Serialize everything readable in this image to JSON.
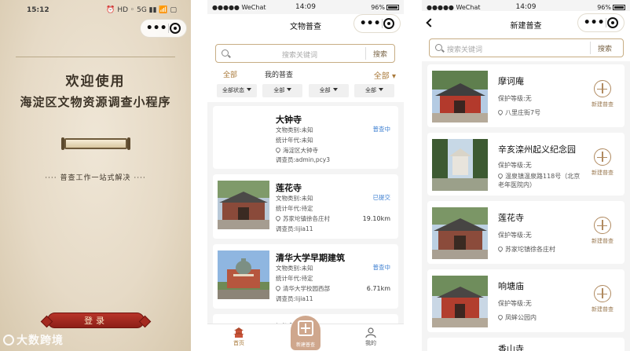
{
  "splash": {
    "status_time": "15:12",
    "status_right": "⏰ HD ◦ 5G ▮▮ 📶 ▢",
    "welcome": "欢迎使用",
    "app_title": "海淀区文物资源调查小程序",
    "slogan": "···· 普查工作一站式解决 ····",
    "login_label": "登录",
    "watermark": "大数跨境"
  },
  "list_screen": {
    "status_left": "●●●●● WeChat",
    "status_time": "14:09",
    "status_battery": "96%",
    "title": "文物普查",
    "search_placeholder": "搜索关键词",
    "search_button": "搜索",
    "tabs": {
      "all": "全部",
      "mine": "我的普查",
      "right": "全部 ▾"
    },
    "filters": [
      "全部状态",
      "全部",
      "全部",
      "全部"
    ],
    "items": [
      {
        "title": "大钟寺",
        "category": "文物类别:未知",
        "era": "统计年代:未知",
        "address": "海淀区大钟寺",
        "surveyor": "调查员:admin,pcy3",
        "status": "普查中",
        "distance": ""
      },
      {
        "title": "莲花寺",
        "category": "文物类别:未知",
        "era": "统计年代:待定",
        "address": "苏家坨镇徐各庄村",
        "surveyor": "调查员:lijia11",
        "status": "已提交",
        "distance": "19.10km"
      },
      {
        "title": "清华大学早期建筑",
        "category": "文物类别:未知",
        "era": "统计年代:待定",
        "address": "清华大学校园西部",
        "surveyor": "调查员:lijia11",
        "status": "普查中",
        "distance": "6.71km"
      },
      {
        "title": "测试"
      }
    ],
    "tabbar": {
      "home": "首页",
      "fab": "新建普查",
      "mine": "我的"
    }
  },
  "new_screen": {
    "status_left": "●●●●● WeChat",
    "status_time": "14:09",
    "status_battery": "96%",
    "title": "新建普查",
    "search_placeholder": "搜索关键词",
    "search_button": "搜索",
    "items": [
      {
        "title": "摩诃庵",
        "level": "保护等级:无",
        "address": "八里庄街7号",
        "add_label": "新建普查"
      },
      {
        "title": "辛亥滦州起义纪念园",
        "level": "保护等级:无",
        "address": "温泉镇温泉路118号（北京老年医院内）",
        "add_label": "新建普查"
      },
      {
        "title": "莲花寺",
        "level": "保护等级:无",
        "address": "苏家坨镇徐各庄村",
        "add_label": "新建普查"
      },
      {
        "title": "响塘庙",
        "level": "保护等级:无",
        "address": "凤蛑公园内",
        "add_label": "新建普查"
      },
      {
        "title": "香山寺"
      }
    ]
  },
  "colors": {
    "accent_gold": "#a9793a",
    "status_blue": "#3d7fd1",
    "login_red": "#9e281e"
  }
}
